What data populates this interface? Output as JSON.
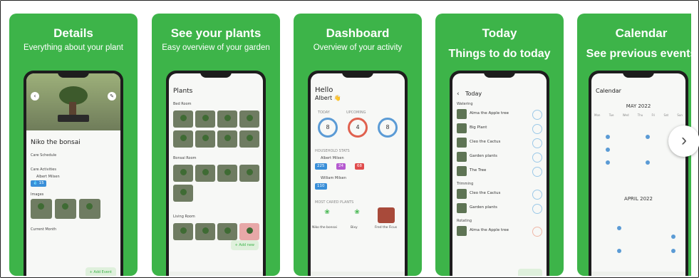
{
  "cards": [
    {
      "title": "Details",
      "subtitle": "Everything about your plant",
      "screen": {
        "plant_name": "Niko the bonsai",
        "care_schedule": "Care Schedule",
        "care_activities": "Care Activities",
        "user": "Albert Milsen",
        "count": "15",
        "images": "Images",
        "current_month": "Current Month",
        "add_event": "Add Event"
      }
    },
    {
      "title": "See your plants",
      "subtitle": "Easy overview of your garden",
      "screen": {
        "header": "Plants",
        "sections": [
          "Bed Room",
          "Bonsai Room",
          "Living Room"
        ],
        "add_new": "Add new"
      }
    },
    {
      "title": "Dashboard",
      "subtitle": "Overview of your activity",
      "screen": {
        "greeting": "Hello",
        "name": "Albert",
        "labels": [
          "TODAY",
          "UPCOMING"
        ],
        "rings": [
          "8",
          "4",
          "8"
        ],
        "household_stats": "HOUSEHOLD STATS",
        "user1": "Albert Milsen",
        "stats": [
          "225",
          "24",
          "68"
        ],
        "user2": "William Milsen",
        "stat2": "110",
        "most_cared": "MOST CARED PLANTS",
        "plants": [
          "Niko the bonsai",
          "Bixy",
          "Fred the Ficus"
        ]
      }
    },
    {
      "title": "Today",
      "subtitle": "Things to do today",
      "screen": {
        "header": "Today",
        "watering": "Watering",
        "items_watering": [
          "Alma the Apple tree",
          "Big Plant",
          "Cleo the Cactus",
          "Garden plants",
          "The Tree"
        ],
        "trimming": "Trimming",
        "items_trimming": [
          "Cleo the Cactus",
          "Garden plants"
        ],
        "rotating": "Rotating",
        "items_rotating": [
          "Alma the Apple tree"
        ]
      }
    },
    {
      "title": "Calendar",
      "subtitle": "See previous events",
      "screen": {
        "header": "Calendar",
        "month1": "MAY 2022",
        "month2": "APRIL 2022",
        "weekdays": [
          "Mon",
          "Tue",
          "Wed",
          "Thu",
          "Fri",
          "Sat",
          "Sun"
        ]
      }
    }
  ],
  "next_button": "›",
  "colors": {
    "green": "#3db449",
    "ring_blue": "#5b9bd5",
    "ring_red": "#e0614f",
    "stat_blue": "#3a8fd8",
    "stat_purple": "#b55ad0",
    "stat_red": "#e04c4c"
  }
}
